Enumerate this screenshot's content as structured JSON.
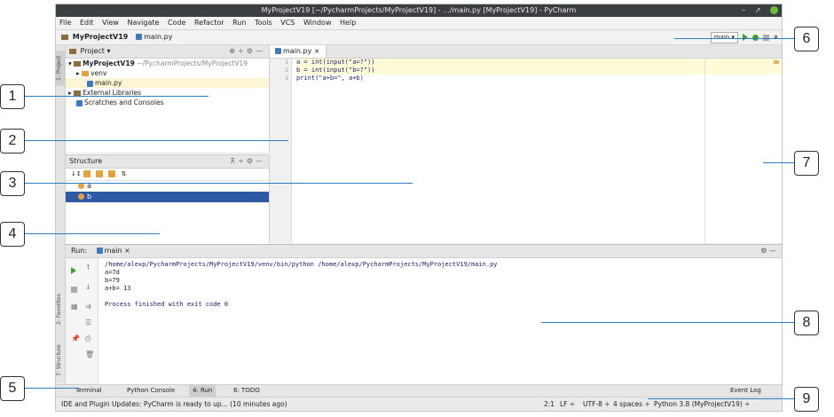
{
  "window": {
    "title": "MyProjectV19 [~/PycharmProjects/MyProjectV19] - .../main.py [MyProjectV19] - PyCharm",
    "controls": [
      "–",
      "↗"
    ]
  },
  "menu": [
    "File",
    "Edit",
    "View",
    "Navigate",
    "Code",
    "Refactor",
    "Run",
    "Tools",
    "VCS",
    "Window",
    "Help"
  ],
  "navbar": {
    "project": "MyProjectV19",
    "file": "main.py",
    "run_config": "main ▾"
  },
  "side_tabs": {
    "project": "1: Project",
    "favorites": "2: Favorites",
    "structure": "7: Structure"
  },
  "project_panel": {
    "title": "Project ▾",
    "root": "MyProjectV19",
    "root_path": "~/PycharmProjects/MyProjectV19",
    "items": [
      "venv",
      "main.py",
      "External Libraries",
      "Scratches and Consoles"
    ]
  },
  "structure_panel": {
    "title": "Structure",
    "items": [
      "a",
      "b"
    ]
  },
  "editor": {
    "tab": "main.py",
    "line_numbers": [
      "1",
      "2",
      "3"
    ],
    "lines": [
      "a = int(input(\"a=?\"))",
      "b = int(input(\"b=?\"))",
      "print(\"a+b=\", a+b)"
    ]
  },
  "run_panel": {
    "label": "Run:",
    "tab": "main",
    "output": [
      "/home/alexp/PycharmProjects/MyProjectV19/venv/bin/python /home/alexp/PycharmProjects/MyProjectV19/main.py",
      "a=7d",
      "b=79",
      "a+b= 13",
      "",
      "Process finished with exit code 0"
    ]
  },
  "bottom_tabs": [
    "Terminal",
    "Python Console",
    "4: Run",
    "6: TODO",
    "Event Log"
  ],
  "status": {
    "message": "IDE and Plugin Updates: PyCharm is ready to up... (10 minutes ago)",
    "position": "2:1",
    "line_sep": "LF ÷",
    "encoding": "UTF-8 ÷",
    "indent": "4 spaces ÷",
    "interpreter": "Python 3.8 (MyProjectV19) ÷"
  },
  "callouts": [
    "1",
    "2",
    "3",
    "4",
    "5",
    "6",
    "7",
    "8",
    "9"
  ],
  "colors": {
    "accent_line": "#2a7fc4",
    "selection": "#2d5aa5",
    "run_green": "#3b9e2f"
  }
}
